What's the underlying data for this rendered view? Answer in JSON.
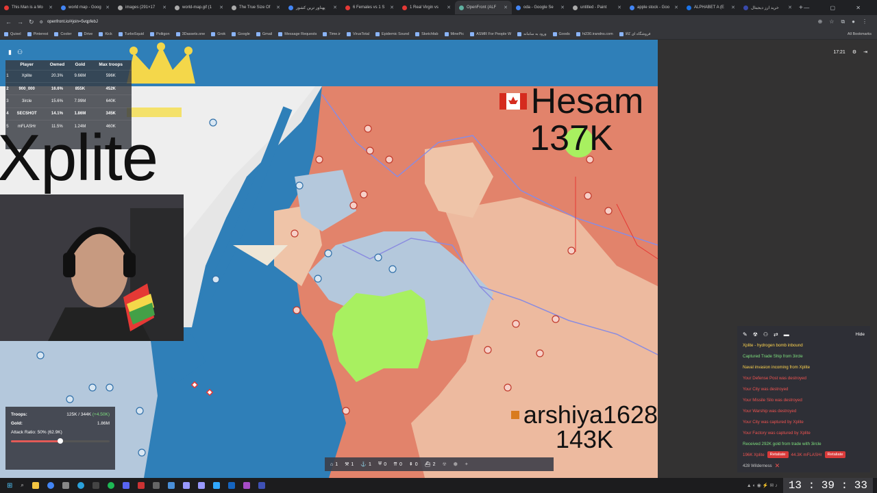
{
  "browser": {
    "tabs": [
      {
        "label": "This Man is a Mo",
        "color": "#e53935"
      },
      {
        "label": "world map - Goog",
        "color": "#4285f4"
      },
      {
        "label": "images (291×17",
        "color": "#aaaaaa"
      },
      {
        "label": "world-map.gif (1",
        "color": "#aaaaaa"
      },
      {
        "label": "The True Size Of",
        "color": "#aaaaaa"
      },
      {
        "label": "پهناور ترین کشور",
        "color": "#4285f4"
      },
      {
        "label": "6 Females vs 1 S",
        "color": "#e53935"
      },
      {
        "label": "1 Real Virgin vs",
        "color": "#e53935"
      },
      {
        "label": "OpenFront (ALF",
        "color": "#5fb0a0",
        "active": true
      },
      {
        "label": "oda - Google Se",
        "color": "#4285f4"
      },
      {
        "label": "untitled - Paint",
        "color": "#aaaaaa"
      },
      {
        "label": "apple stock - Goo",
        "color": "#4285f4"
      },
      {
        "label": "ALPHABET A (E",
        "color": "#1a73e8"
      },
      {
        "label": "خرید ارز دیجیتال",
        "color": "#3949ab"
      }
    ],
    "url": "openfront.io/#join=5vqpfebJ",
    "bookmarks": [
      "Quixel",
      "Pinterest",
      "Cooler",
      "Drive",
      "Kick",
      "TurboSquid",
      "Poliigon",
      "3Dassets.one",
      "Grok",
      "Google",
      "Gmail",
      "Message Requests",
      "Time.ir",
      "VirusTotal",
      "Epidemic Sound",
      "Sketchfab",
      "MinePic",
      "ASMR For People W",
      "ورود به سامانه",
      "Goods",
      "hi230.irandns.com",
      "فروشگاه ای کالا"
    ],
    "all_bookmarks": "All Bookmarks"
  },
  "leaderboard": {
    "headers": [
      "Player",
      "Owned",
      "Gold",
      "Max troops"
    ],
    "rows": [
      {
        "rank": "1",
        "player": "Xplite",
        "owned": "20.3%",
        "gold": "9.66M",
        "troops": "596K"
      },
      {
        "rank": "2",
        "player": "900_000",
        "owned": "16.6%",
        "gold": "855K",
        "troops": "452K"
      },
      {
        "rank": "3",
        "player": "3ircle",
        "owned": "15.6%",
        "gold": "7.99M",
        "troops": "640K"
      },
      {
        "rank": "4",
        "player": "SECSHOT",
        "owned": "14.1%",
        "gold": "1.86M",
        "troops": "345K"
      },
      {
        "rank": "5",
        "player": "mFLASHr",
        "owned": "11.5%",
        "gold": "1.24M",
        "troops": "460K"
      }
    ]
  },
  "game_time": "17:21",
  "big_label": "Xplite",
  "players": {
    "hesam": {
      "name": "Hesam",
      "troops": "137K"
    },
    "arshiya": {
      "name": "arshiya1628",
      "troops": "143K"
    }
  },
  "stats": {
    "troops_label": "Troops:",
    "troops_value": "125K / 344K",
    "troops_delta": "(+4.50K)",
    "gold_label": "Gold:",
    "gold_value": "1.86M",
    "attack_ratio_label": "Attack Ratio: 50% (62.9K)",
    "attack_ratio": 0.5
  },
  "events": {
    "hide_label": "Hide",
    "items": [
      {
        "text": "Xplite - hydrogen bomb inbound",
        "color": "#ffd54f"
      },
      {
        "text": "Captured Trade Ship from 3ircle",
        "color": "#7ee07e"
      },
      {
        "text": "Naval invasion incoming from Xplite",
        "color": "#ffd54f"
      },
      {
        "text": "Your Defense Post was destroyed",
        "color": "#ef5350"
      },
      {
        "text": "Your City was destroyed",
        "color": "#ef5350"
      },
      {
        "text": "Your Missile Silo was destroyed",
        "color": "#ef5350"
      },
      {
        "text": "Your Warship was destroyed",
        "color": "#ef5350"
      },
      {
        "text": "Your City was captured by Xplite",
        "color": "#ef5350"
      },
      {
        "text": "Your Factory was captured by Xplite",
        "color": "#ef5350"
      },
      {
        "text": "Received 292K gold from trade with 3ircle",
        "color": "#7ee07e"
      }
    ],
    "attack_rows": [
      {
        "left_text": "196K Xplite",
        "left_button": "Retaliate",
        "right_text": "44.3K mFLASHr",
        "right_button": "Retaliate"
      }
    ],
    "wilderness": "428 Wilderness"
  },
  "unit_bar": [
    {
      "icon": "city-icon",
      "count": "1"
    },
    {
      "icon": "factory-icon",
      "count": "1"
    },
    {
      "icon": "port-icon",
      "count": "1"
    },
    {
      "icon": "defense-post-icon",
      "count": "0"
    },
    {
      "icon": "missile-silo-icon",
      "count": "0"
    },
    {
      "icon": "sam-launcher-icon",
      "count": "0"
    },
    {
      "icon": "warship-icon",
      "count": "2"
    }
  ],
  "clock": "13 : 39 : 33",
  "colors": {
    "ocean": "#2f7fb8",
    "enemy": "#e2836b",
    "enemy_light": "#efc4a8",
    "ally": "#b4c8dc",
    "xplite": "#a8f060",
    "highlight": "#e53935"
  }
}
